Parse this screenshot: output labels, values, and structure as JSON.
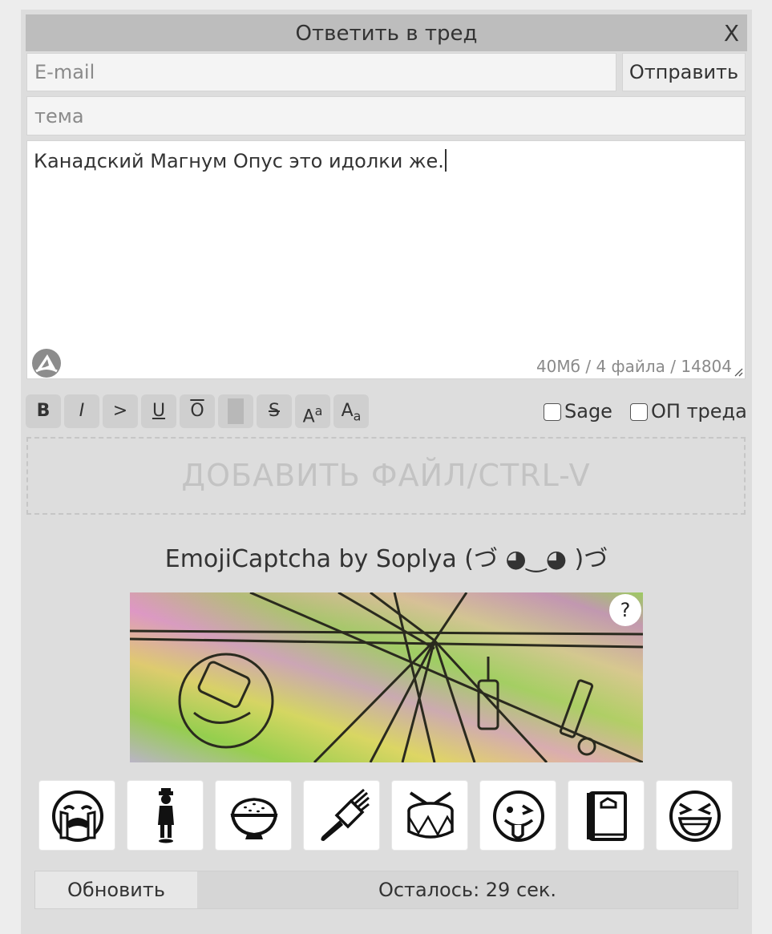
{
  "form": {
    "title": "Ответить в тред",
    "close_label": "X",
    "email_placeholder": "E-mail",
    "email_value": "",
    "submit_label": "Отправить",
    "subject_placeholder": "тема",
    "subject_value": "",
    "message_text": "Канадский Магнум Опус это идолки же.",
    "limits": "40Мб / 4 файла / 14804"
  },
  "toolbar": {
    "bold": "B",
    "italic": "I",
    "quote": ">",
    "underline": "U",
    "overline": "O",
    "strike": "S",
    "sup_base": "A",
    "sup_mark": "a",
    "sub_base": "A",
    "sub_mark": "a",
    "sage_label": "Sage",
    "op_label": "ОП треда"
  },
  "dropzone": {
    "label": "ДОБАВИТЬ ФАЙЛ/CTRL-V"
  },
  "captcha": {
    "title": "EmojiCaptcha by Soplya (づ ◕‿◕ )づ",
    "help_label": "?",
    "options": [
      {
        "icon": "loudly-crying-face-icon"
      },
      {
        "icon": "man-in-suit-levitating-icon"
      },
      {
        "icon": "rice-bowl-icon"
      },
      {
        "icon": "hair-pick-icon"
      },
      {
        "icon": "drum-icon"
      },
      {
        "icon": "winking-face-tongue-icon"
      },
      {
        "icon": "notebook-icon"
      },
      {
        "icon": "grinning-squinting-face-icon"
      }
    ],
    "refresh_label": "Обновить",
    "timer_text": "Осталось: 29 сек."
  }
}
